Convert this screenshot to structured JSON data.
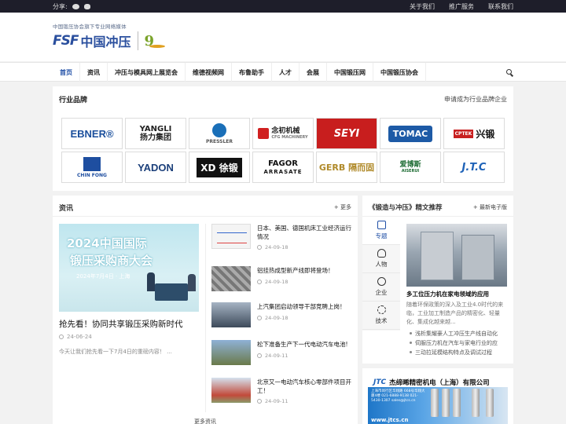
{
  "topbar": {
    "share_label": "分享:",
    "links": [
      "关于我们",
      "推广服务",
      "联系我们"
    ]
  },
  "header": {
    "logo_subtitle": "中国锻压协会旗下专业网络媒体",
    "logo_mark": "FSF",
    "logo_name": "中国冲压"
  },
  "nav": {
    "items": [
      "首页",
      "资讯",
      "冲压与模具网上展览会",
      "维德视频网",
      "布鲁助手",
      "人才",
      "会展",
      "中国锻压网",
      "中国锻压协会"
    ],
    "active": "首页"
  },
  "brands": {
    "title": "行业品牌",
    "apply_link": "申请成为行业品牌企业",
    "row1": [
      {
        "name": "EBNER®"
      },
      {
        "name": "YANGLI",
        "sub": "扬力集团"
      },
      {
        "name": "PRESSLER"
      },
      {
        "name": "念初机械",
        "sub": "CFG MACHINERY"
      },
      {
        "name": "SEYI"
      },
      {
        "name": "TOMAC"
      },
      {
        "name": "兴锻",
        "sub": "CPTEK"
      }
    ],
    "row2": [
      {
        "name": "CHIN FONG"
      },
      {
        "name": "YADON"
      },
      {
        "name": "XD 徐锻"
      },
      {
        "name": "FAGOR",
        "sub": "ARRASATE"
      },
      {
        "name": "GERB 隔而固"
      },
      {
        "name": "爱博斯",
        "sub": "AISERUI"
      },
      {
        "name": "J.T.C"
      }
    ]
  },
  "news": {
    "title": "资讯",
    "more": "+ 更多",
    "hero": {
      "img_line1": "2024中国国际",
      "img_line2": "锻压采购商大会",
      "img_line3": "2024年7月4日 · 上海",
      "title": "抢先看！协同共享锻压采购新时代",
      "date": "24-06-24",
      "desc": "今天让我们抢先看一下7月4日的重磅内容！ ..."
    },
    "items": [
      {
        "title": "日本、美国、德国机床工业经济运行情况",
        "date": "24-09-18"
      },
      {
        "title": "铝挂热成型新产线即将登场！",
        "date": "24-09-18"
      },
      {
        "title": "上汽集团启动领导干部竞聘上岗！",
        "date": "24-09-18"
      },
      {
        "title": "松下准备生产下一代电动汽车电池!",
        "date": "24-09-11"
      },
      {
        "title": "北京又一电动汽车核心零部件项目开工！",
        "date": "24-09-11"
      }
    ],
    "more_news": "更多资讯"
  },
  "recommend": {
    "title": "《锻造与冲压》精文推荐",
    "more": "+ 最新电子版",
    "tabs": [
      "专题",
      "人物",
      "企业",
      "技术"
    ],
    "active_tab": "专题",
    "article_title": "多工位压力机在家电领域的应用",
    "article_desc": "随着环保政策的深入及工业4.0时代的来临，工业加工制造产品的精密化、轻量化、集成化越来越...",
    "list": [
      "浅析集耀豪人工冲压生产线自动化",
      "伺服压力机在汽车与家电行业的应",
      "三动拉延模结构特点及调试过程"
    ]
  },
  "ad": {
    "brand": "JTC",
    "company": "杰缔晞精密机电（上海）有限公司",
    "body_text": "上海市闵行区华翔路 668号华翔大厦4楼 021-6888-9138 021-5430-1307 sales@jtcs.cn",
    "url": "www.jtcs.cn"
  }
}
